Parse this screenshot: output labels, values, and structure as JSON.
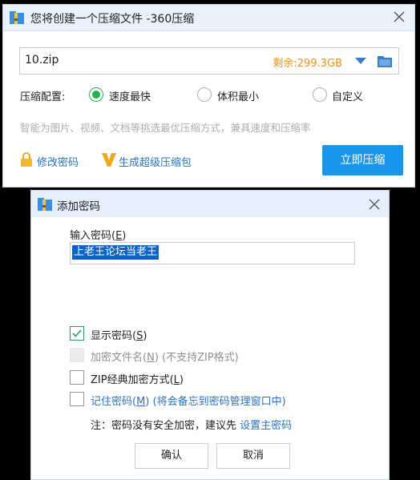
{
  "colors": {
    "accent": "#1897ea",
    "free_space": "#e8931f",
    "radio_checked": "#25b24a",
    "link": "#2a72c2",
    "title_bar": "#e9f1fb"
  },
  "compress_window": {
    "title": "您将创建一个压缩文件 -360压缩",
    "icon": "archive-app-icon",
    "filename": "10.zip",
    "free_space": "剩余:299.3GB",
    "config_label": "压缩配置:",
    "options": [
      {
        "label": "速度最快",
        "checked": true
      },
      {
        "label": "体积最小",
        "checked": false
      },
      {
        "label": "自定义",
        "checked": false
      }
    ],
    "hint": "智能为图片、视频、文档等挑选最优压缩方式，兼具速度和压缩率",
    "change_password_link": "修改密码",
    "super_package_link": "生成超级压缩包",
    "compress_button": "立即压缩"
  },
  "password_dialog": {
    "title": "添加密码",
    "input_label_prefix": "输入密码(",
    "input_label_key": "E",
    "input_label_suffix": ")",
    "password_value": "上老王论坛当老王",
    "checkboxes": [
      {
        "prefix": "显示密码(",
        "key": "S",
        "suffix": ")",
        "checked": true,
        "disabled": false
      },
      {
        "prefix": "加密文件名(",
        "key": "N",
        "suffix": ") (不支持ZIP格式)",
        "checked": false,
        "disabled": true
      },
      {
        "prefix": "ZIP经典加密方式(",
        "key": "L",
        "suffix": ")",
        "checked": false,
        "disabled": false
      },
      {
        "prefix": "记住密码(",
        "key": "M",
        "suffix": ") (将会备忘到密码管理窗口中)",
        "checked": false,
        "disabled": false
      }
    ],
    "note_text": "注：密码没有安全加密，建议先 ",
    "note_link": "设置主密码",
    "ok_button": "确认",
    "cancel_button": "取消"
  }
}
